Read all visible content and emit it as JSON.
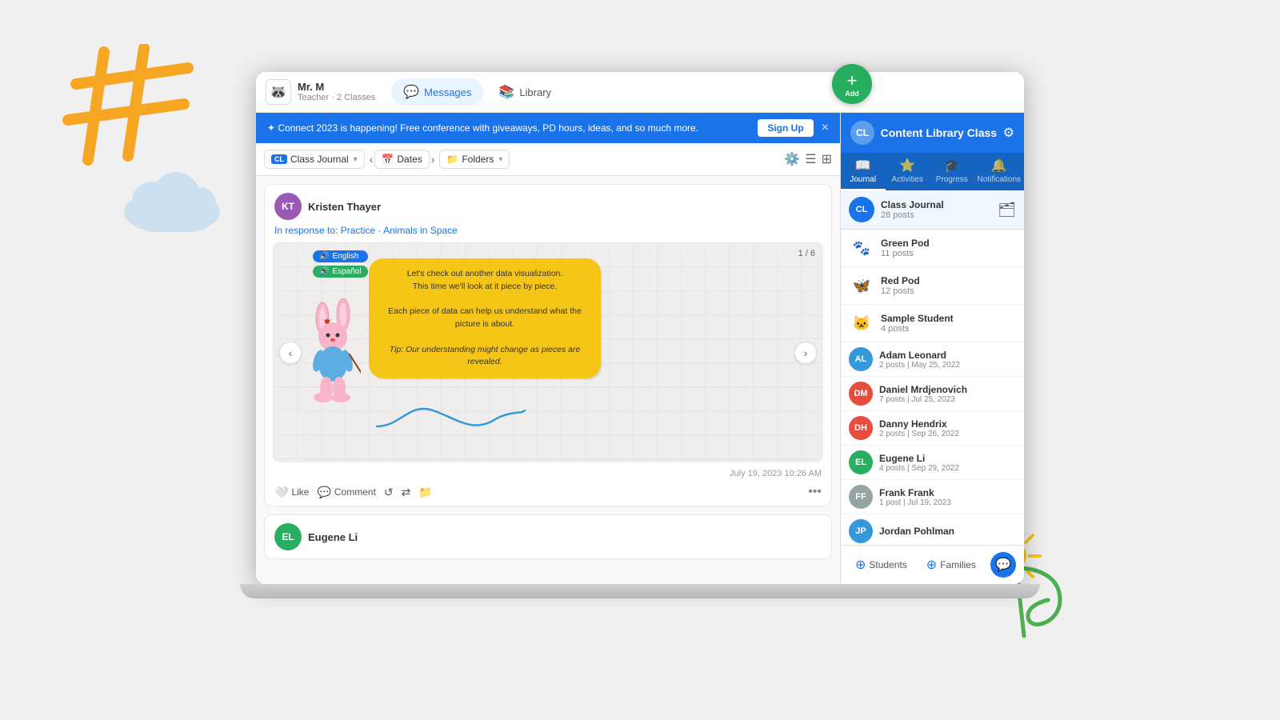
{
  "decorative": {
    "hashtag": "#",
    "sun": "☀",
    "swirl": "ℊ"
  },
  "teacher": {
    "name": "Mr. M",
    "role": "Teacher · 2 Classes",
    "avatar_emoji": "🦝"
  },
  "nav": {
    "tabs": [
      {
        "id": "messages",
        "label": "Messages",
        "icon": "💬",
        "active": true
      },
      {
        "id": "library",
        "label": "Library",
        "icon": "📚",
        "active": false
      }
    ]
  },
  "banner": {
    "text": "✦ Connect 2023 is happening! Free conference with giveaways, PD hours, ideas, and so much more.",
    "btn_label": "Sign Up",
    "close_label": "×"
  },
  "filter_bar": {
    "journal_label": "Class Journal",
    "dates_label": "Dates",
    "folders_label": "Folders",
    "nav_prev": "‹",
    "nav_next": "›"
  },
  "fab": {
    "plus": "+",
    "label": "Add"
  },
  "posts": [
    {
      "id": "post1",
      "user_initials": "KT",
      "user_name": "Kristen Thayer",
      "avatar_color": "#9b59b6",
      "in_response": "In response to: Practice · Animals in Space",
      "slide_counter": "1 / 6",
      "audio_btns": [
        {
          "label": "English",
          "color": "blue"
        },
        {
          "label": "Español",
          "color": "green"
        }
      ],
      "bubble_lines": [
        "Let's check out another data visualization.",
        "This time we'll look at it piece by piece.",
        "",
        "Each piece of data can help us understand what the picture is about.",
        "",
        "Tip: Our understanding might change as pieces are revealed."
      ],
      "bubble_text": "Let's check out another data visualization.\nThis time we'll look at it piece by piece.\n\nEach piece of data can help us understand what the picture is about.\n\nTip: Our understanding might change as pieces are revealed.",
      "timestamp": "July 19, 2023 10:26 AM",
      "actions": [
        "Like",
        "Comment"
      ]
    },
    {
      "id": "post2",
      "user_initials": "EL",
      "user_name": "Eugene Li",
      "avatar_color": "#27ae60"
    }
  ],
  "sidebar": {
    "cl_label": "CL",
    "title": "Content Library Class",
    "settings_icon": "⚙",
    "tabs": [
      {
        "id": "journal",
        "label": "Journal",
        "icon": "📖",
        "active": true
      },
      {
        "id": "activities",
        "label": "Activities",
        "icon": "⭐"
      },
      {
        "id": "progress",
        "label": "Progress",
        "icon": "🎓"
      },
      {
        "id": "notifications",
        "label": "Notifications",
        "icon": "🔔"
      }
    ],
    "journal_section": {
      "cl_initials": "CL",
      "name": "Class Journal",
      "count": "28 posts",
      "folder_icon": "🗂"
    },
    "groups": [
      {
        "id": "green_pod",
        "name": "Green Pod",
        "meta": "11 posts",
        "avatar_type": "animal",
        "avatar_emoji": "🐾"
      },
      {
        "id": "red_pod",
        "name": "Red Pod",
        "meta": "12 posts",
        "avatar_type": "butterfly",
        "avatar_emoji": "🦋"
      },
      {
        "id": "sample_student",
        "name": "Sample Student",
        "meta": "4 posts",
        "avatar_type": "animal",
        "avatar_emoji": "🐱"
      }
    ],
    "students": [
      {
        "id": "adam",
        "initials": "AL",
        "name": "Adam Leonard",
        "meta": "2 posts | May 25, 2022",
        "color": "#3498db"
      },
      {
        "id": "daniel",
        "initials": "DM",
        "name": "Daniel Mrdjenovich",
        "meta": "7 posts | Jul 25, 2023",
        "color": "#e74c3c"
      },
      {
        "id": "danny",
        "initials": "DH",
        "name": "Danny Hendrix",
        "meta": "2 posts | Sep 26, 2022",
        "color": "#e74c3c"
      },
      {
        "id": "eugene",
        "initials": "EL",
        "name": "Eugene Li",
        "meta": "4 posts | Sep 29, 2022",
        "color": "#27ae60"
      },
      {
        "id": "frank",
        "initials": "FF",
        "name": "Frank Frank",
        "meta": "1 post | Jul 19, 2023",
        "color": "#95a5a6"
      },
      {
        "id": "jordan",
        "initials": "JP",
        "name": "Jordan Pohlman",
        "meta": "",
        "color": "#3498db"
      }
    ],
    "footer": {
      "students_label": "Students",
      "families_label": "Families",
      "students_icon": "⊕",
      "families_icon": "⊕",
      "chat_icon": "💬"
    }
  }
}
